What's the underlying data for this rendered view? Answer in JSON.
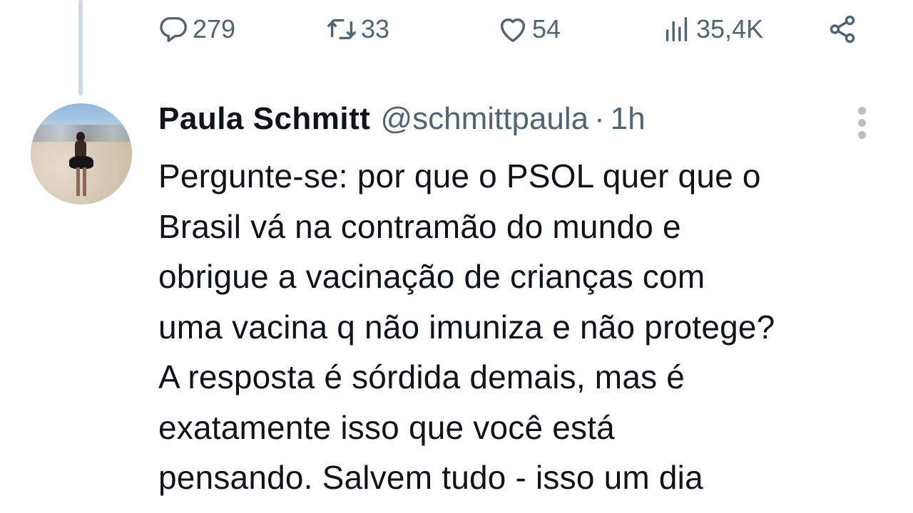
{
  "actions": {
    "reply": {
      "icon": "reply-icon",
      "count": "279"
    },
    "retweet": {
      "icon": "retweet-icon",
      "count": "33"
    },
    "like": {
      "icon": "heart-icon",
      "count": "54"
    },
    "views": {
      "icon": "views-chart-icon",
      "count": "35,4K"
    },
    "share": {
      "icon": "share-icon"
    }
  },
  "tweet": {
    "author_name": "Paula Schmitt",
    "handle": "@schmittpaula",
    "separator": "·",
    "time": "1h",
    "text": "Pergunte-se: por que o PSOL quer que o\nBrasil vá na contramão do mundo e\nobrigue a vacinação de crianças com\numa vacina q não imuniza e não protege?\nA resposta é sórdida demais, mas é\nexatamente isso que você está\npensando. Salvem tudo - isso um dia"
  },
  "colors": {
    "text_primary": "#0f1419",
    "text_secondary": "#536471",
    "thread_line": "#cfd9de",
    "background": "#ffffff"
  }
}
